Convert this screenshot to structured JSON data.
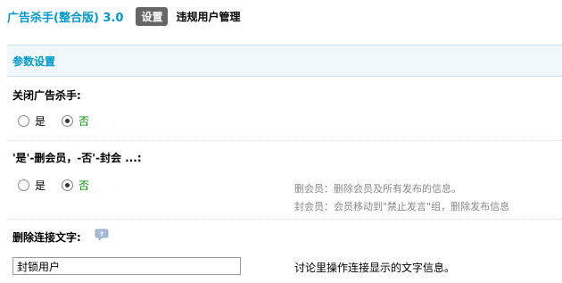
{
  "header": {
    "title": "广告杀手(整合版) 3.0",
    "tab_active": "设置",
    "tab_link": "违规用户管理"
  },
  "section": {
    "title": "参数设置"
  },
  "settings": {
    "close_killer": {
      "label": "关闭广告杀手:",
      "options": [
        "是",
        "否"
      ],
      "selected": "否"
    },
    "action": {
      "label": "'是'-删会员，-否'-封会 ...:",
      "options": [
        "是",
        "否"
      ],
      "selected": "否",
      "hint_delete": "删会员：删除会员及所有发布的信息。",
      "hint_ban": "封会员：会员移动到\"禁止发言\"组，删除发布信息"
    },
    "delete_link_text": {
      "label": "删除连接文字:",
      "help_icon": "speech-bubble-help-icon",
      "value": "封锁用户",
      "hint": "讨论里操作连接显示的文字信息。"
    }
  },
  "colors": {
    "accent": "#0099cc",
    "checked_label": "#009900",
    "section_bg": "#f2f9fd"
  }
}
